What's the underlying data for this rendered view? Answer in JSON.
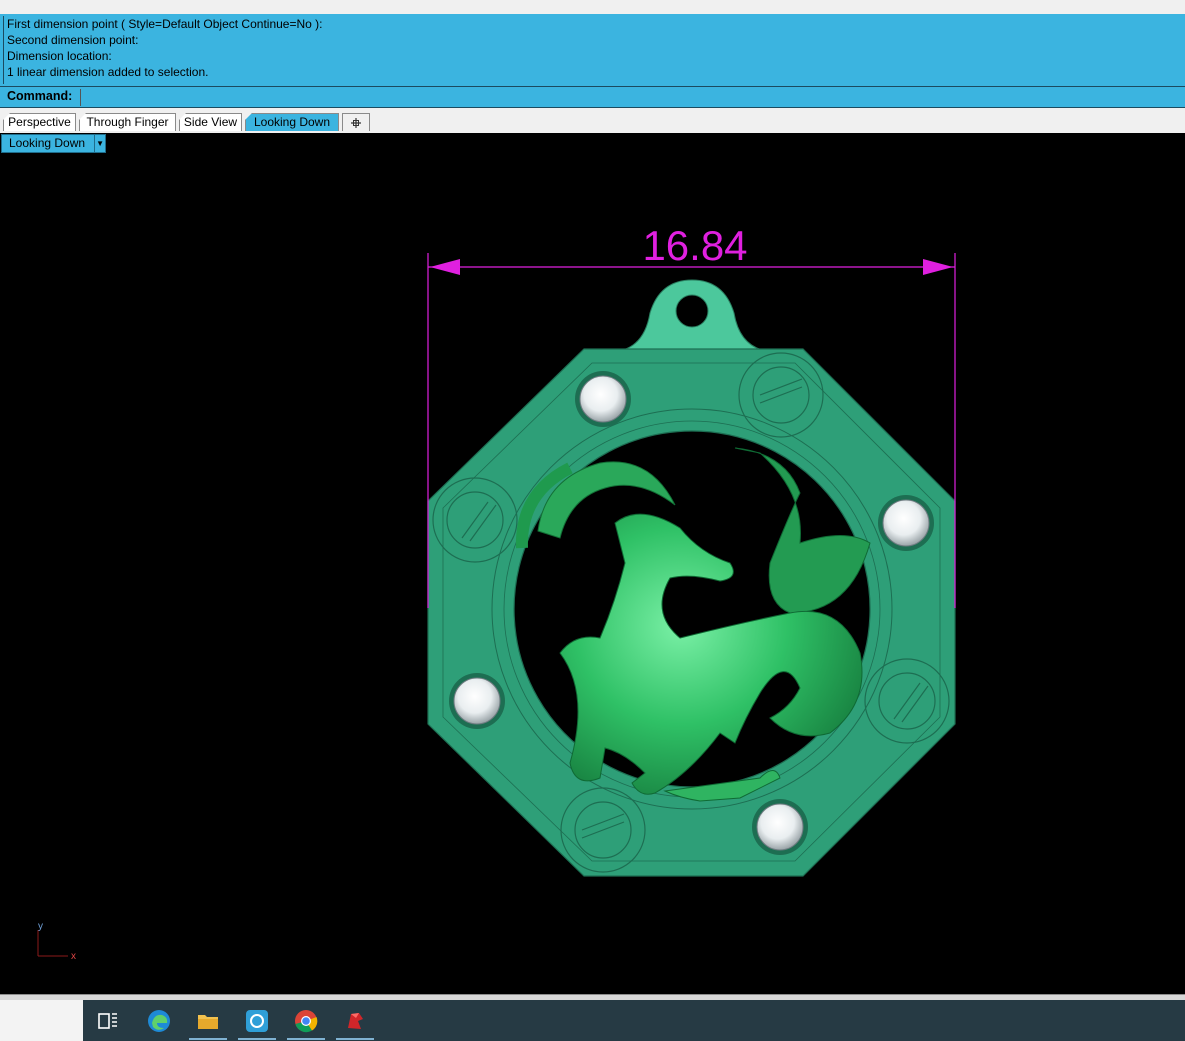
{
  "history": {
    "lines": [
      "First dimension point ( Style=Default  Object  Continue=No ):",
      "Second dimension point:",
      "Dimension location:",
      "1 linear dimension added to selection."
    ]
  },
  "command": {
    "label": "Command:",
    "value": ""
  },
  "tabs": [
    {
      "label": "Perspective",
      "active": false
    },
    {
      "label": "Through Finger",
      "active": false
    },
    {
      "label": "Side View",
      "active": false
    },
    {
      "label": "Looking Down",
      "active": true
    }
  ],
  "add_tab_icon": "plus-icon",
  "viewport": {
    "title": "Looking Down",
    "dropdown_icon": "chevron-down-icon",
    "dimension_value": "16.84",
    "axis_y": "y",
    "axis_x": "x"
  },
  "colors": {
    "history_bg": "#3bb4e0",
    "viewport_bg": "#000000",
    "dimension": "#e020e0",
    "model_green": "#2e9f78",
    "taskbar_bg": "#263a44"
  },
  "taskbar": {
    "icons": [
      "task-view-icon",
      "edge-browser-icon",
      "file-explorer-icon",
      "vs-tool-icon",
      "chrome-icon",
      "rhino-icon"
    ]
  }
}
